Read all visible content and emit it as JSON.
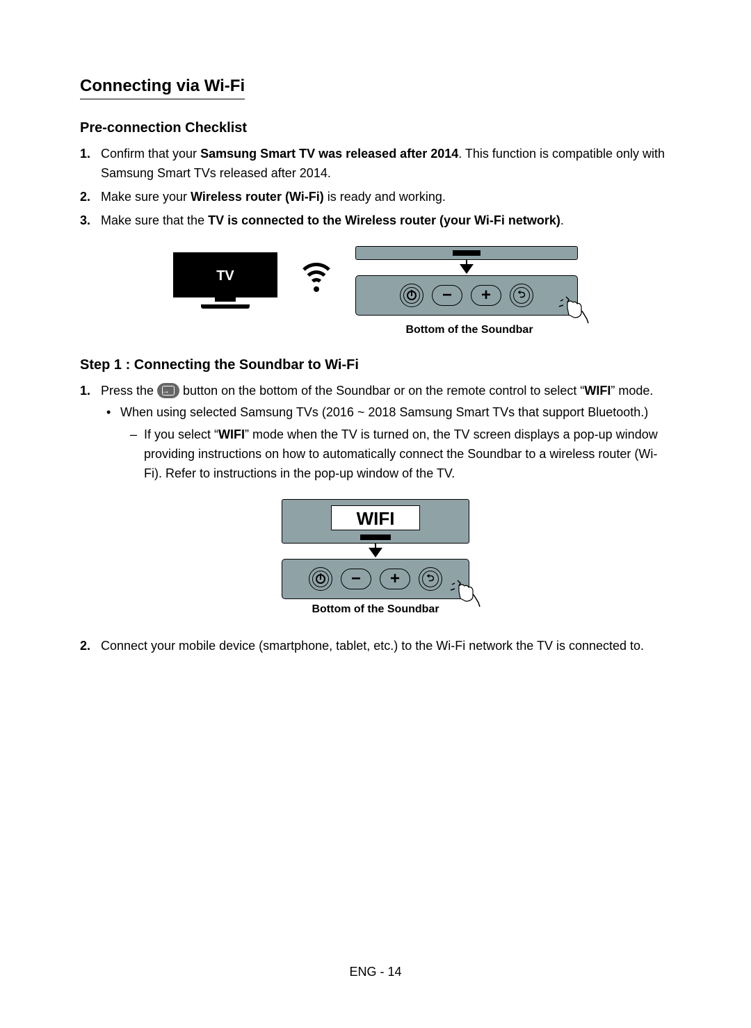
{
  "section_title": "Connecting via Wi-Fi",
  "checklist": {
    "heading": "Pre-connection Checklist",
    "items": [
      {
        "num": "1.",
        "pre": "Confirm that your ",
        "bold": "Samsung Smart TV was released after 2014",
        "post": ". This function is compatible only with Samsung Smart TVs released after 2014."
      },
      {
        "num": "2.",
        "pre": "Make sure your ",
        "bold": "Wireless router (Wi-Fi)",
        "post": " is ready and working."
      },
      {
        "num": "3.",
        "pre": "Make sure that the ",
        "bold": "TV is connected to the Wireless router (your Wi-Fi network)",
        "post": "."
      }
    ]
  },
  "tv_label": "TV",
  "figure1_caption": "Bottom of the Soundbar",
  "step1": {
    "heading": "Step 1 : Connecting the Soundbar to Wi-Fi",
    "item1": {
      "num": "1.",
      "pre": "Press the ",
      "post_a": " button on the bottom of the Soundbar or on the remote control to select “",
      "bold": "WIFI",
      "post_b": "” mode."
    },
    "bullet": "When using selected Samsung TVs (2016 ~ 2018 Samsung Smart TVs that support Bluetooth.)",
    "dash": {
      "pre": "If you select “",
      "bold": "WIFI",
      "post": "” mode when the TV is turned on, the TV screen displays a pop-up window providing instructions on how to automatically connect the Soundbar to a wireless router (Wi-Fi). Refer to instructions in the pop-up window of the TV."
    },
    "display_label": "WIFI",
    "figure2_caption": "Bottom of the Soundbar",
    "item2": {
      "num": "2.",
      "text": "Connect your mobile device (smartphone, tablet, etc.) to the Wi-Fi network the TV is connected to."
    }
  },
  "footer": "ENG - 14"
}
